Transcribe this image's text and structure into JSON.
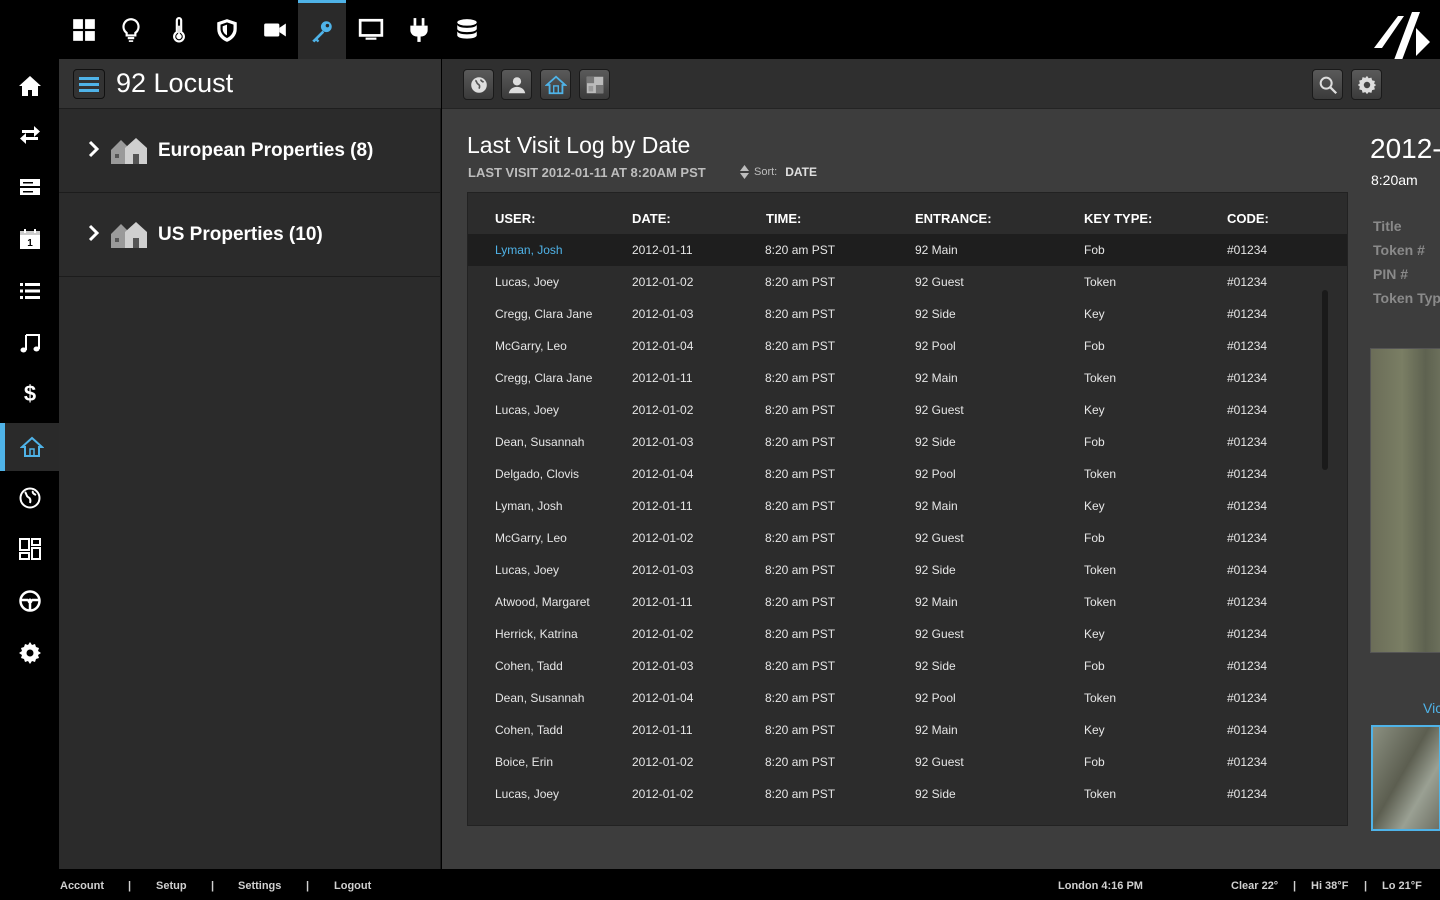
{
  "accent_color": "#4fb3e8",
  "top_nav": {
    "icons": [
      "dashboard-icon",
      "lightbulb-icon",
      "thermometer-icon",
      "shield-icon",
      "video-camera-icon",
      "key-icon",
      "monitor-icon",
      "plug-icon",
      "database-icon"
    ],
    "active": "key-icon",
    "logo": "brand-logo"
  },
  "left_nav": {
    "icons": [
      "home-icon",
      "transfer-icon",
      "server-icon",
      "calendar-icon",
      "list-icon",
      "music-icon",
      "dollar-icon",
      "house-outline-icon",
      "globe-icon",
      "widgets-icon",
      "steering-wheel-icon",
      "gear-icon"
    ],
    "active": "house-outline-icon"
  },
  "sidepanel": {
    "title": "92 Locust",
    "groups": [
      {
        "label": "European Properties (8)"
      },
      {
        "label": "US Properties (10)"
      }
    ]
  },
  "toolbar": {
    "left_buttons": [
      "globe-icon",
      "user-icon",
      "home-icon",
      "floorplan-icon"
    ],
    "right_buttons": [
      "search-icon",
      "gear-icon"
    ]
  },
  "log": {
    "title": "Last Visit Log by Date",
    "subtitle": "LAST VISIT 2012-01-11 AT 8:20AM PST",
    "sort_label": "Sort:",
    "sort_value": "DATE",
    "columns": [
      "USER:",
      "DATE:",
      "TIME:",
      "ENTRANCE:",
      "KEY TYPE:",
      "CODE:"
    ],
    "rows": [
      [
        "Lyman, Josh",
        "2012-01-11",
        "8:20 am PST",
        "92 Main",
        "Fob",
        "#01234"
      ],
      [
        "Lucas, Joey",
        "2012-01-02",
        "8:20 am PST",
        "92 Guest",
        "Token",
        "#01234"
      ],
      [
        "Cregg, Clara Jane",
        "2012-01-03",
        "8:20 am PST",
        "92 Side",
        "Key",
        "#01234"
      ],
      [
        "McGarry, Leo",
        "2012-01-04",
        "8:20 am PST",
        "92 Pool",
        "Fob",
        "#01234"
      ],
      [
        "Cregg, Clara Jane",
        "2012-01-11",
        "8:20 am PST",
        "92 Main",
        "Token",
        "#01234"
      ],
      [
        "Lucas, Joey",
        "2012-01-02",
        "8:20 am PST",
        "92 Guest",
        "Key",
        "#01234"
      ],
      [
        "Dean, Susannah",
        "2012-01-03",
        "8:20 am PST",
        "92 Side",
        "Fob",
        "#01234"
      ],
      [
        "Delgado, Clovis",
        "2012-01-04",
        "8:20 am PST",
        "92 Pool",
        "Token",
        "#01234"
      ],
      [
        "Lyman, Josh",
        "2012-01-11",
        "8:20 am PST",
        "92 Main",
        "Key",
        "#01234"
      ],
      [
        "McGarry, Leo",
        "2012-01-02",
        "8:20 am PST",
        "92 Guest",
        "Fob",
        "#01234"
      ],
      [
        "Lucas, Joey",
        "2012-01-03",
        "8:20 am PST",
        "92 Side",
        "Token",
        "#01234"
      ],
      [
        "Atwood, Margaret",
        "2012-01-11",
        "8:20 am PST",
        "92 Main",
        "Token",
        "#01234"
      ],
      [
        "Herrick, Katrina",
        "2012-01-02",
        "8:20 am PST",
        "92 Guest",
        "Key",
        "#01234"
      ],
      [
        "Cohen, Tadd",
        "2012-01-03",
        "8:20 am PST",
        "92 Side",
        "Fob",
        "#01234"
      ],
      [
        "Dean, Susannah",
        "2012-01-04",
        "8:20 am PST",
        "92 Pool",
        "Token",
        "#01234"
      ],
      [
        "Cohen, Tadd",
        "2012-01-11",
        "8:20 am PST",
        "92 Main",
        "Key",
        "#01234"
      ],
      [
        "Boice, Erin",
        "2012-01-02",
        "8:20 am PST",
        "92 Guest",
        "Fob",
        "#01234"
      ],
      [
        "Lucas, Joey",
        "2012-01-02",
        "8:20 am PST",
        "92 Side",
        "Token",
        "#01234"
      ]
    ]
  },
  "detail": {
    "date": "2012-",
    "time": "8:20am",
    "labels": [
      "Title",
      "Token #",
      "PIN #",
      "Token Typ"
    ],
    "view_link": "Vic"
  },
  "footer": {
    "links": [
      "Account",
      "Setup",
      "Settings",
      "Logout"
    ],
    "separator": "|",
    "clock": "London 4:16 PM",
    "weather": "Clear 22°",
    "high": "Hi 38°F",
    "low": "Lo 21°F"
  }
}
